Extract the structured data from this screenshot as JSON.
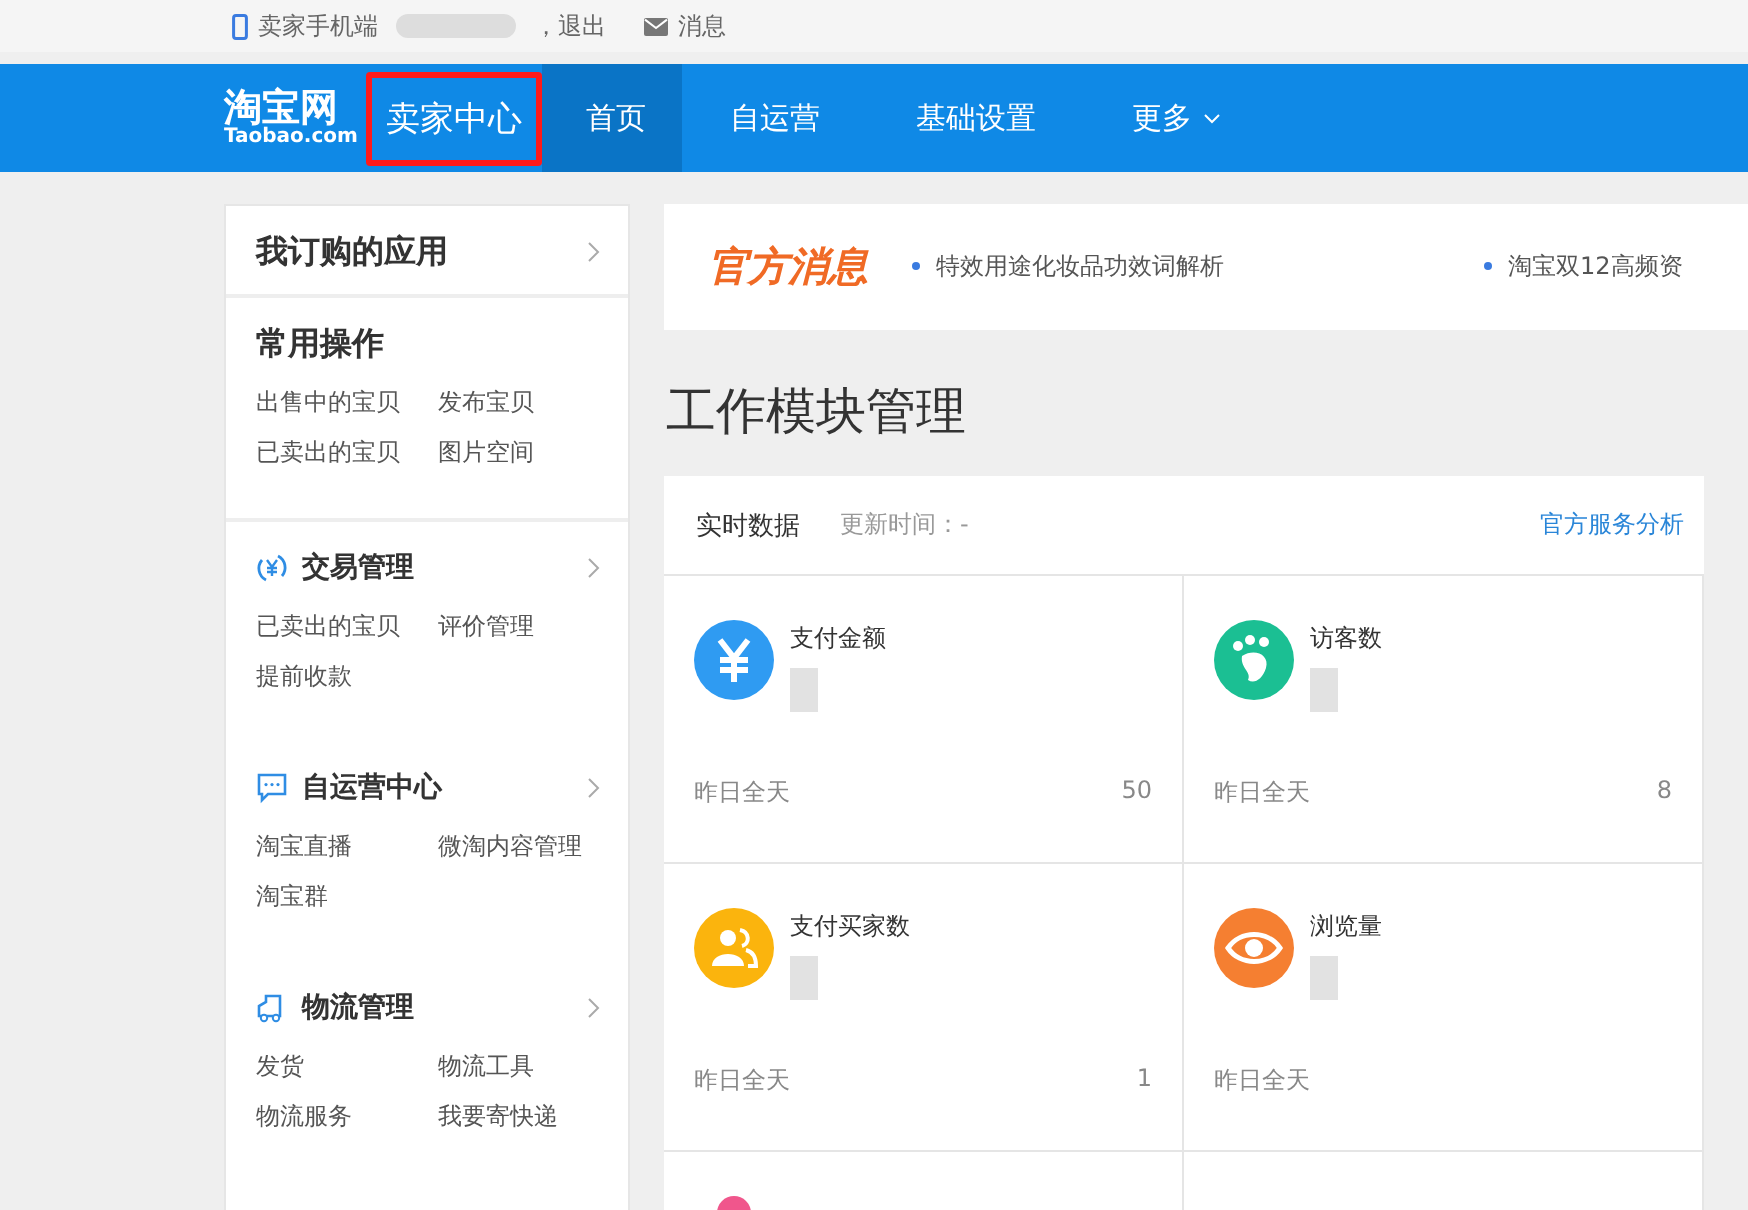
{
  "top_bar": {
    "mobile_link": "卖家手机端",
    "logout": "，退出",
    "messages": "消息"
  },
  "header": {
    "logo_title": "淘宝网",
    "logo_subtitle": "Taobao.com",
    "site_name": "卖家中心",
    "site_name_highlighted": true,
    "nav": [
      {
        "label": "首页",
        "selected": true,
        "dropdown": false
      },
      {
        "label": "自运营",
        "selected": false,
        "dropdown": false
      },
      {
        "label": "基础设置",
        "selected": false,
        "dropdown": false
      },
      {
        "label": "更多",
        "selected": false,
        "dropdown": true
      }
    ]
  },
  "sidebar": {
    "sections": [
      {
        "title": "我订购的应用",
        "kind": "apps"
      },
      {
        "title": "常用操作",
        "kind": "common",
        "links": [
          "出售中的宝贝",
          "发布宝贝",
          "已卖出的宝贝",
          "图片空间"
        ]
      },
      {
        "title": "交易管理",
        "kind": "trade",
        "links": [
          "已卖出的宝贝",
          "评价管理",
          "提前收款"
        ]
      },
      {
        "title": "自运营中心",
        "kind": "operation",
        "links": [
          "淘宝直播",
          "微淘内容管理",
          "淘宝群"
        ]
      },
      {
        "title": "物流管理",
        "kind": "logistics",
        "links": [
          "发货",
          "物流工具",
          "物流服务",
          "我要寄快递"
        ]
      }
    ]
  },
  "notice": {
    "title": "官方消息",
    "items": [
      "特效用途化妆品功效词解析",
      "淘宝双12高频资"
    ]
  },
  "module_title": "工作模块管理",
  "realtime": {
    "title": "实时数据",
    "update_time": "更新时间：-",
    "link": "官方服务分析",
    "cards": [
      {
        "label": "支付金额",
        "kind": "amount",
        "color": "#2f9bf2",
        "footer": "昨日全天",
        "value": "50"
      },
      {
        "label": "访客数",
        "kind": "visitors",
        "color": "#1bbf93",
        "footer": "昨日全天",
        "value": "8"
      },
      {
        "label": "支付买家数",
        "kind": "buyers",
        "color": "#fbb40d",
        "footer": "昨日全天",
        "value": "1"
      },
      {
        "label": "浏览量",
        "kind": "views",
        "color": "#f57f31",
        "footer": "昨日全天"
      }
    ]
  }
}
